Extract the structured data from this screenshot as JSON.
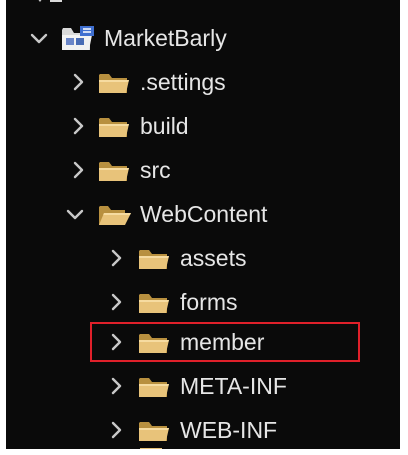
{
  "tree": {
    "project": {
      "label": "MarketBarly",
      "icon": "java-project-icon",
      "expanded": true
    },
    "items": [
      {
        "label": ".settings",
        "icon": "folder-icon",
        "expanded": false
      },
      {
        "label": "build",
        "icon": "folder-icon",
        "expanded": false
      },
      {
        "label": "src",
        "icon": "folder-icon",
        "expanded": false
      },
      {
        "label": "WebContent",
        "icon": "folder-open-icon",
        "expanded": true
      },
      {
        "label": "assets",
        "icon": "folder-icon",
        "expanded": false
      },
      {
        "label": "forms",
        "icon": "folder-icon",
        "expanded": false
      },
      {
        "label": "member",
        "icon": "folder-icon",
        "expanded": false,
        "highlighted": true
      },
      {
        "label": "META-INF",
        "icon": "folder-icon",
        "expanded": false
      },
      {
        "label": "WEB-INF",
        "icon": "folder-icon",
        "expanded": false
      }
    ]
  },
  "colors": {
    "background": "#0a0a0a",
    "text": "#e6e6e6",
    "chevron": "#c8c8c8",
    "folder": "#e8c37a",
    "highlight_border": "#e0202a"
  }
}
